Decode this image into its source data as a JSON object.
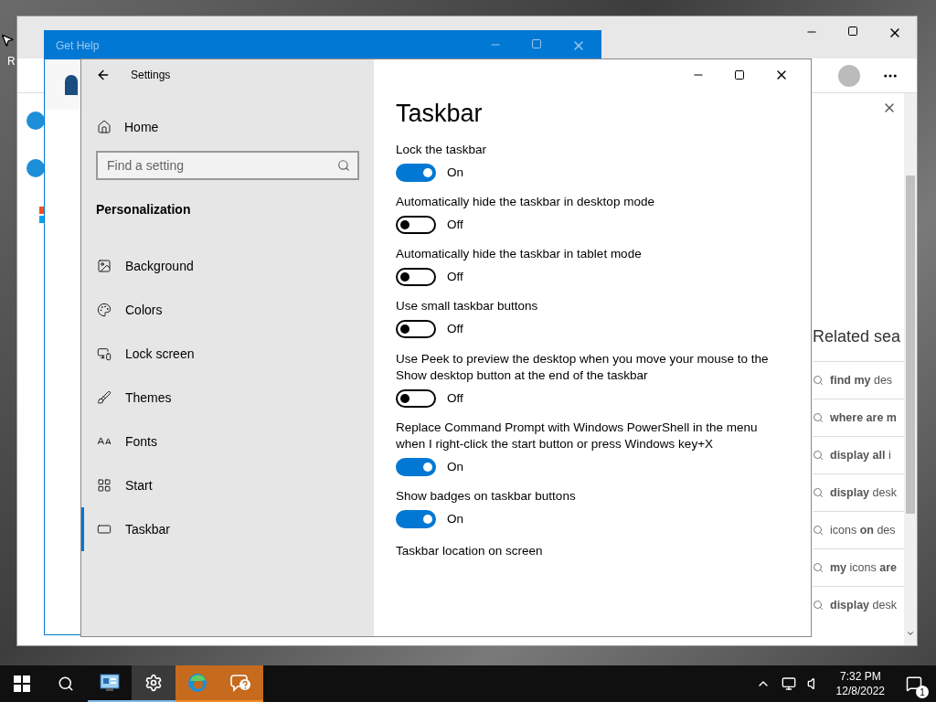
{
  "desktop": {
    "icon_label": "R"
  },
  "browser": {
    "related_title": "Related sea",
    "related": [
      {
        "text": "**find my** des"
      },
      {
        "text": "**where are m**"
      },
      {
        "text": "**display all** i"
      },
      {
        "text": "**display** desk"
      },
      {
        "text": "icons **on** des"
      },
      {
        "text": "**my** icons **are**"
      },
      {
        "text": "**display** desk"
      }
    ]
  },
  "get_help": {
    "title": "Get Help"
  },
  "settings": {
    "title": "Settings",
    "home": "Home",
    "search": {
      "placeholder": "Find a setting"
    },
    "section": "Personalization",
    "nav": [
      {
        "kind": "background",
        "label": "Background",
        "selected": false
      },
      {
        "kind": "colors",
        "label": "Colors",
        "selected": false
      },
      {
        "kind": "lockscreen",
        "label": "Lock screen",
        "selected": false
      },
      {
        "kind": "themes",
        "label": "Themes",
        "selected": false
      },
      {
        "kind": "fonts",
        "label": "Fonts",
        "selected": false
      },
      {
        "kind": "start",
        "label": "Start",
        "selected": false
      },
      {
        "kind": "taskbar",
        "label": "Taskbar",
        "selected": true
      }
    ],
    "page_title": "Taskbar",
    "options": [
      {
        "label": "Lock the taskbar",
        "on": true,
        "state_text": "On"
      },
      {
        "label": "Automatically hide the taskbar in desktop mode",
        "on": false,
        "state_text": "Off"
      },
      {
        "label": "Automatically hide the taskbar in tablet mode",
        "on": false,
        "state_text": "Off"
      },
      {
        "label": "Use small taskbar buttons",
        "on": false,
        "state_text": "Off"
      },
      {
        "label": "Use Peek to preview the desktop when you move your mouse to the Show desktop button at the end of the taskbar",
        "on": false,
        "state_text": "Off"
      },
      {
        "label": "Replace Command Prompt with Windows PowerShell in the menu when I right-click the start button or press Windows key+X",
        "on": true,
        "state_text": "On"
      },
      {
        "label": "Show badges on taskbar buttons",
        "on": true,
        "state_text": "On"
      }
    ],
    "last_label": "Taskbar location on screen"
  },
  "taskbar": {
    "apps": [
      {
        "kind": "control-panel",
        "active": false,
        "flashing": false
      },
      {
        "kind": "settings",
        "active": true,
        "flashing": false
      },
      {
        "kind": "edge",
        "active": false,
        "flashing": true
      },
      {
        "kind": "help",
        "active": false,
        "flashing": true
      }
    ],
    "time": "7:32 PM",
    "date": "12/8/2022",
    "notification_count": "1"
  }
}
